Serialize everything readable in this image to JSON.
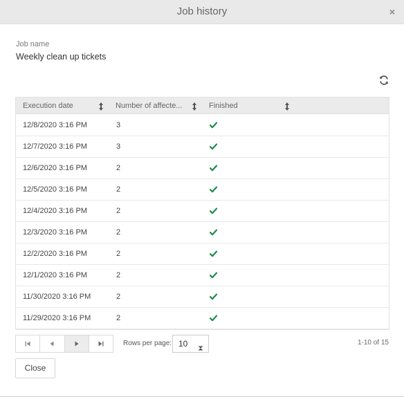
{
  "dialog": {
    "title": "Job history",
    "close_glyph": "×"
  },
  "job": {
    "label": "Job name",
    "value": "Weekly clean up tickets"
  },
  "table": {
    "columns": [
      {
        "label": "Execution date"
      },
      {
        "label": "Number of affecte..."
      },
      {
        "label": "Finished"
      }
    ],
    "rows": [
      {
        "date": "12/8/2020 3:16 PM",
        "count": "3",
        "finished": true
      },
      {
        "date": "12/7/2020 3:16 PM",
        "count": "3",
        "finished": true
      },
      {
        "date": "12/6/2020 3:16 PM",
        "count": "2",
        "finished": true
      },
      {
        "date": "12/5/2020 3:16 PM",
        "count": "2",
        "finished": true
      },
      {
        "date": "12/4/2020 3:16 PM",
        "count": "2",
        "finished": true
      },
      {
        "date": "12/3/2020 3:16 PM",
        "count": "2",
        "finished": true
      },
      {
        "date": "12/2/2020 3:16 PM",
        "count": "2",
        "finished": true
      },
      {
        "date": "12/1/2020 3:16 PM",
        "count": "2",
        "finished": true
      },
      {
        "date": "11/30/2020 3:16 PM",
        "count": "2",
        "finished": true
      },
      {
        "date": "11/29/2020 3:16 PM",
        "count": "2",
        "finished": true
      }
    ]
  },
  "pager": {
    "rows_per_page_label": "Rows per page:",
    "rows_per_page_value": "10",
    "page_info": "1-10 of 15"
  },
  "footer": {
    "close_label": "Close"
  },
  "colors": {
    "check": "#1e8a4c",
    "header_bg": "#ebebeb",
    "titlebar_bg": "#e9e9e9"
  },
  "icons": {
    "refresh": "refresh-icon",
    "sort": "sort-icon",
    "check": "check-icon",
    "first": "first-page-icon",
    "prev": "previous-page-icon",
    "next": "next-page-icon",
    "last": "last-page-icon",
    "dropdown": "dropdown-arrow-icon"
  }
}
